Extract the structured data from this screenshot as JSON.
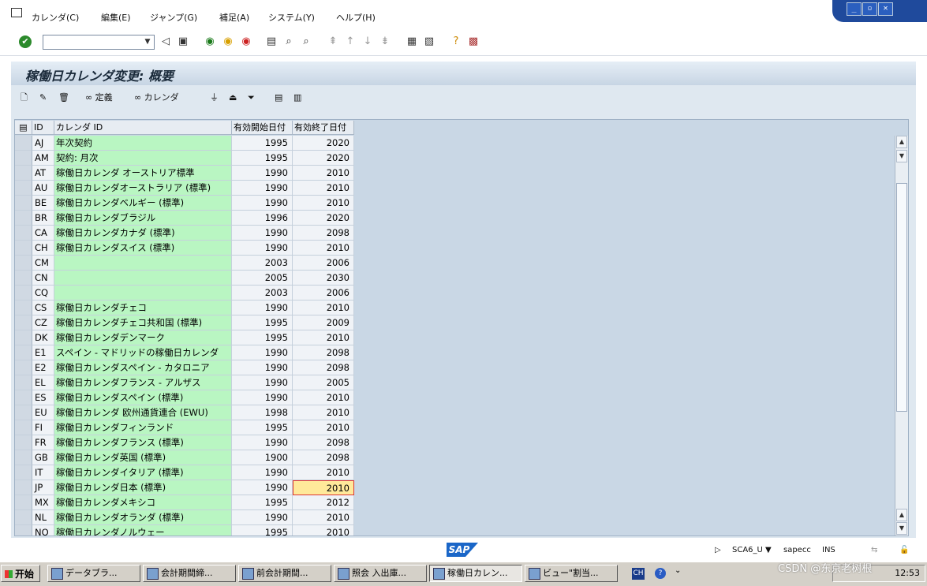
{
  "menubar": {
    "items": [
      "カレンダ(C)",
      "編集(E)",
      "ジャンプ(G)",
      "補足(A)",
      "システム(Y)",
      "ヘルプ(H)"
    ]
  },
  "window_controls": [
    "minimize-icon",
    "restore-icon",
    "close-icon"
  ],
  "toolbar": {
    "command_field_value": "",
    "icons": [
      "enter-icon",
      "back-icon",
      "save-icon",
      "back-green-icon",
      "exit-icon",
      "cancel-icon",
      "print-icon",
      "find-icon",
      "find-next-icon",
      "first-page-icon",
      "prev-page-icon",
      "next-page-icon",
      "last-page-icon",
      "new-session-icon",
      "shortcut-icon",
      "help-icon",
      "layout-icon"
    ]
  },
  "title": "稼働日カレンダ変更: 概要",
  "app_toolbar": {
    "definition_label": "定義",
    "calendar_label": "カレンダ"
  },
  "table": {
    "headers": [
      "ID",
      "カレンダ ID",
      "有効開始日付",
      "有効終了日付"
    ],
    "rows": [
      {
        "id": "AJ",
        "name": "年次契約",
        "start": "1995",
        "end": "2020"
      },
      {
        "id": "AM",
        "name": "契約: 月次",
        "start": "1995",
        "end": "2020"
      },
      {
        "id": "AT",
        "name": "稼働日カレンダ オーストリア標準",
        "start": "1990",
        "end": "2010"
      },
      {
        "id": "AU",
        "name": "稼働日カレンダオーストラリア (標準)",
        "start": "1990",
        "end": "2010"
      },
      {
        "id": "BE",
        "name": "稼働日カレンダベルギー (標準)",
        "start": "1990",
        "end": "2010"
      },
      {
        "id": "BR",
        "name": "稼働日カレンダブラジル",
        "start": "1996",
        "end": "2020"
      },
      {
        "id": "CA",
        "name": "稼働日カレンダカナダ (標準)",
        "start": "1990",
        "end": "2098"
      },
      {
        "id": "CH",
        "name": "稼働日カレンダスイス (標準)",
        "start": "1990",
        "end": "2010"
      },
      {
        "id": "CM",
        "name": "",
        "start": "2003",
        "end": "2006"
      },
      {
        "id": "CN",
        "name": "",
        "start": "2005",
        "end": "2030"
      },
      {
        "id": "CQ",
        "name": "",
        "start": "2003",
        "end": "2006"
      },
      {
        "id": "CS",
        "name": "稼働日カレンダチェコ",
        "start": "1990",
        "end": "2010"
      },
      {
        "id": "CZ",
        "name": "稼働日カレンダチェコ共和国 (標準)",
        "start": "1995",
        "end": "2009"
      },
      {
        "id": "DK",
        "name": "稼働日カレンダデンマーク",
        "start": "1995",
        "end": "2010"
      },
      {
        "id": "E1",
        "name": "スペイン - マドリッドの稼働日カレンダ",
        "start": "1990",
        "end": "2098"
      },
      {
        "id": "E2",
        "name": "稼働日カレンダスペイン - カタロニア",
        "start": "1990",
        "end": "2098"
      },
      {
        "id": "EL",
        "name": "稼働日カレンダフランス - アルザス",
        "start": "1990",
        "end": "2005"
      },
      {
        "id": "ES",
        "name": "稼働日カレンダスペイン (標準)",
        "start": "1990",
        "end": "2010"
      },
      {
        "id": "EU",
        "name": "稼働日カレンダ 欧州通貨連合 (EWU)",
        "start": "1998",
        "end": "2010"
      },
      {
        "id": "FI",
        "name": "稼働日カレンダフィンランド",
        "start": "1995",
        "end": "2010"
      },
      {
        "id": "FR",
        "name": "稼働日カレンダフランス (標準)",
        "start": "1990",
        "end": "2098"
      },
      {
        "id": "GB",
        "name": "稼働日カレンダ英国 (標準)",
        "start": "1900",
        "end": "2098"
      },
      {
        "id": "IT",
        "name": "稼働日カレンダイタリア (標準)",
        "start": "1990",
        "end": "2010"
      },
      {
        "id": "JP",
        "name": "稼働日カレンダ日本 (標準)",
        "start": "1990",
        "end": "2010"
      },
      {
        "id": "MX",
        "name": "稼働日カレンダメキシコ",
        "start": "1995",
        "end": "2012"
      },
      {
        "id": "NL",
        "name": "稼働日カレンダオランダ (標準)",
        "start": "1990",
        "end": "2010"
      },
      {
        "id": "NO",
        "name": "稼働日カレンダノルウェー",
        "start": "1995",
        "end": "2010"
      }
    ],
    "highlighted_row_id": "JP"
  },
  "status": {
    "logo": "SAP",
    "session": "SCA6_U",
    "server": "sapecc",
    "mode": "INS"
  },
  "taskbar": {
    "start_label": "开始",
    "tasks": [
      "データブラ...",
      "会計期間締...",
      "前会計期間...",
      "照会 入出庫...",
      "稼働日カレン...",
      "ビュー\"割当..."
    ],
    "active_task_index": 4,
    "ime": "CH",
    "clock": "12:53"
  },
  "watermark": "CSDN @东京老树根"
}
